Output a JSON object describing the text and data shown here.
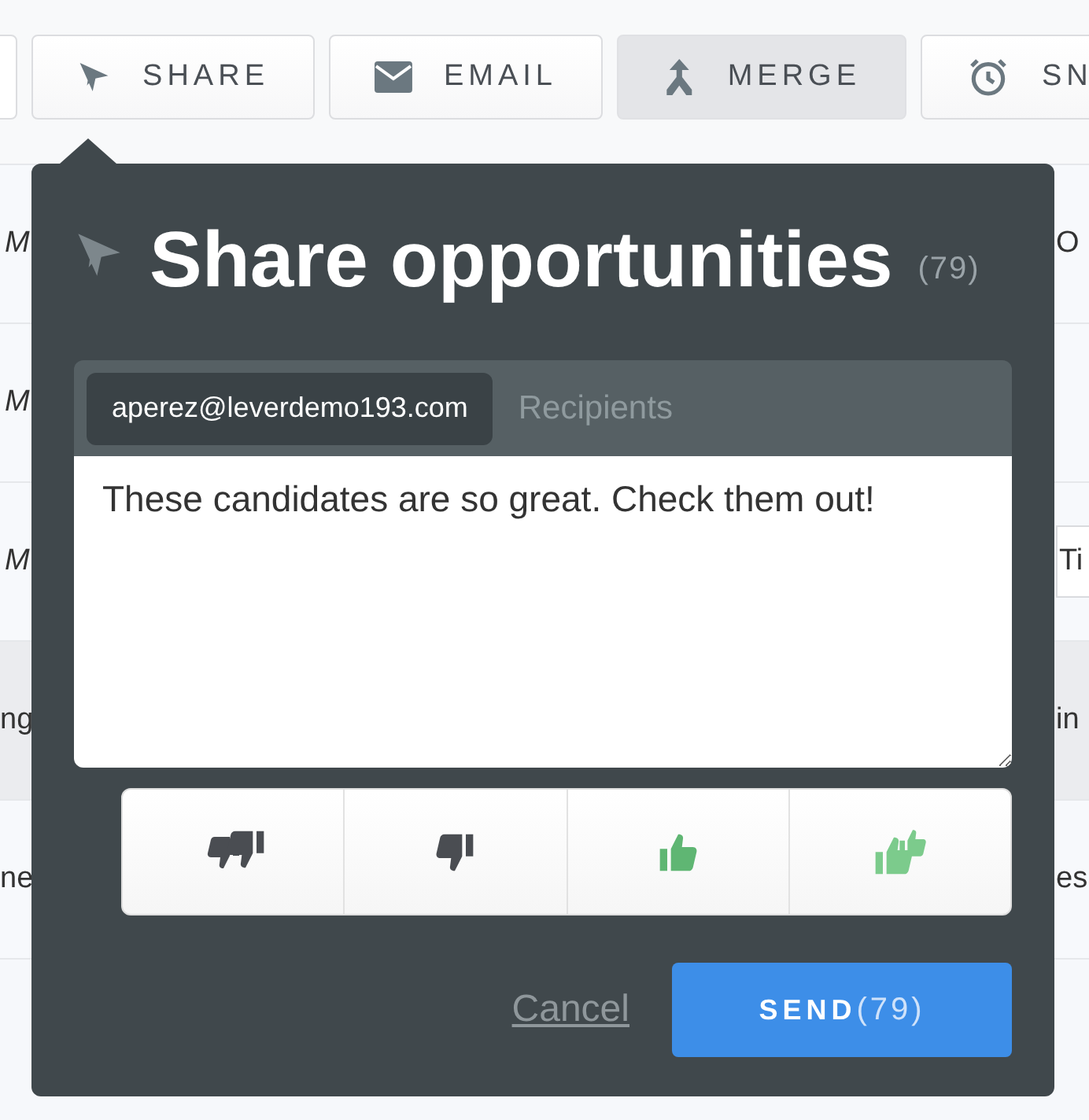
{
  "toolbar": [
    {
      "label": "SHARE",
      "selected": false
    },
    {
      "label": "EMAIL",
      "selected": false
    },
    {
      "label": "MERGE",
      "selected": true
    },
    {
      "label": "SN",
      "selected": false
    }
  ],
  "table": {
    "rows": [
      {
        "column_1": "M",
        "column_2": "O",
        "selected": false
      },
      {
        "column_1": "M",
        "selected": false
      },
      {
        "column_1": "M",
        "column_2": "Ti",
        "selected": false
      },
      {
        "column_1": "ng",
        "column_2": "in",
        "selected": true
      },
      {
        "column_1": "ne",
        "column_2": "es",
        "selected": false
      }
    ]
  },
  "dialog": {
    "title": "Share opportunities",
    "count": "(79)",
    "recipients": {
      "chips": [
        "aperez@leverdemo193.com"
      ],
      "placeholder": "Recipients"
    },
    "message": "These candidates are so great. Check them out!",
    "ratings": [
      {
        "kind": "strong-no"
      },
      {
        "kind": "no"
      },
      {
        "kind": "yes"
      },
      {
        "kind": "strong-yes"
      }
    ],
    "cancel": "Cancel",
    "send": {
      "label": "SEND",
      "count": "(79)"
    }
  }
}
